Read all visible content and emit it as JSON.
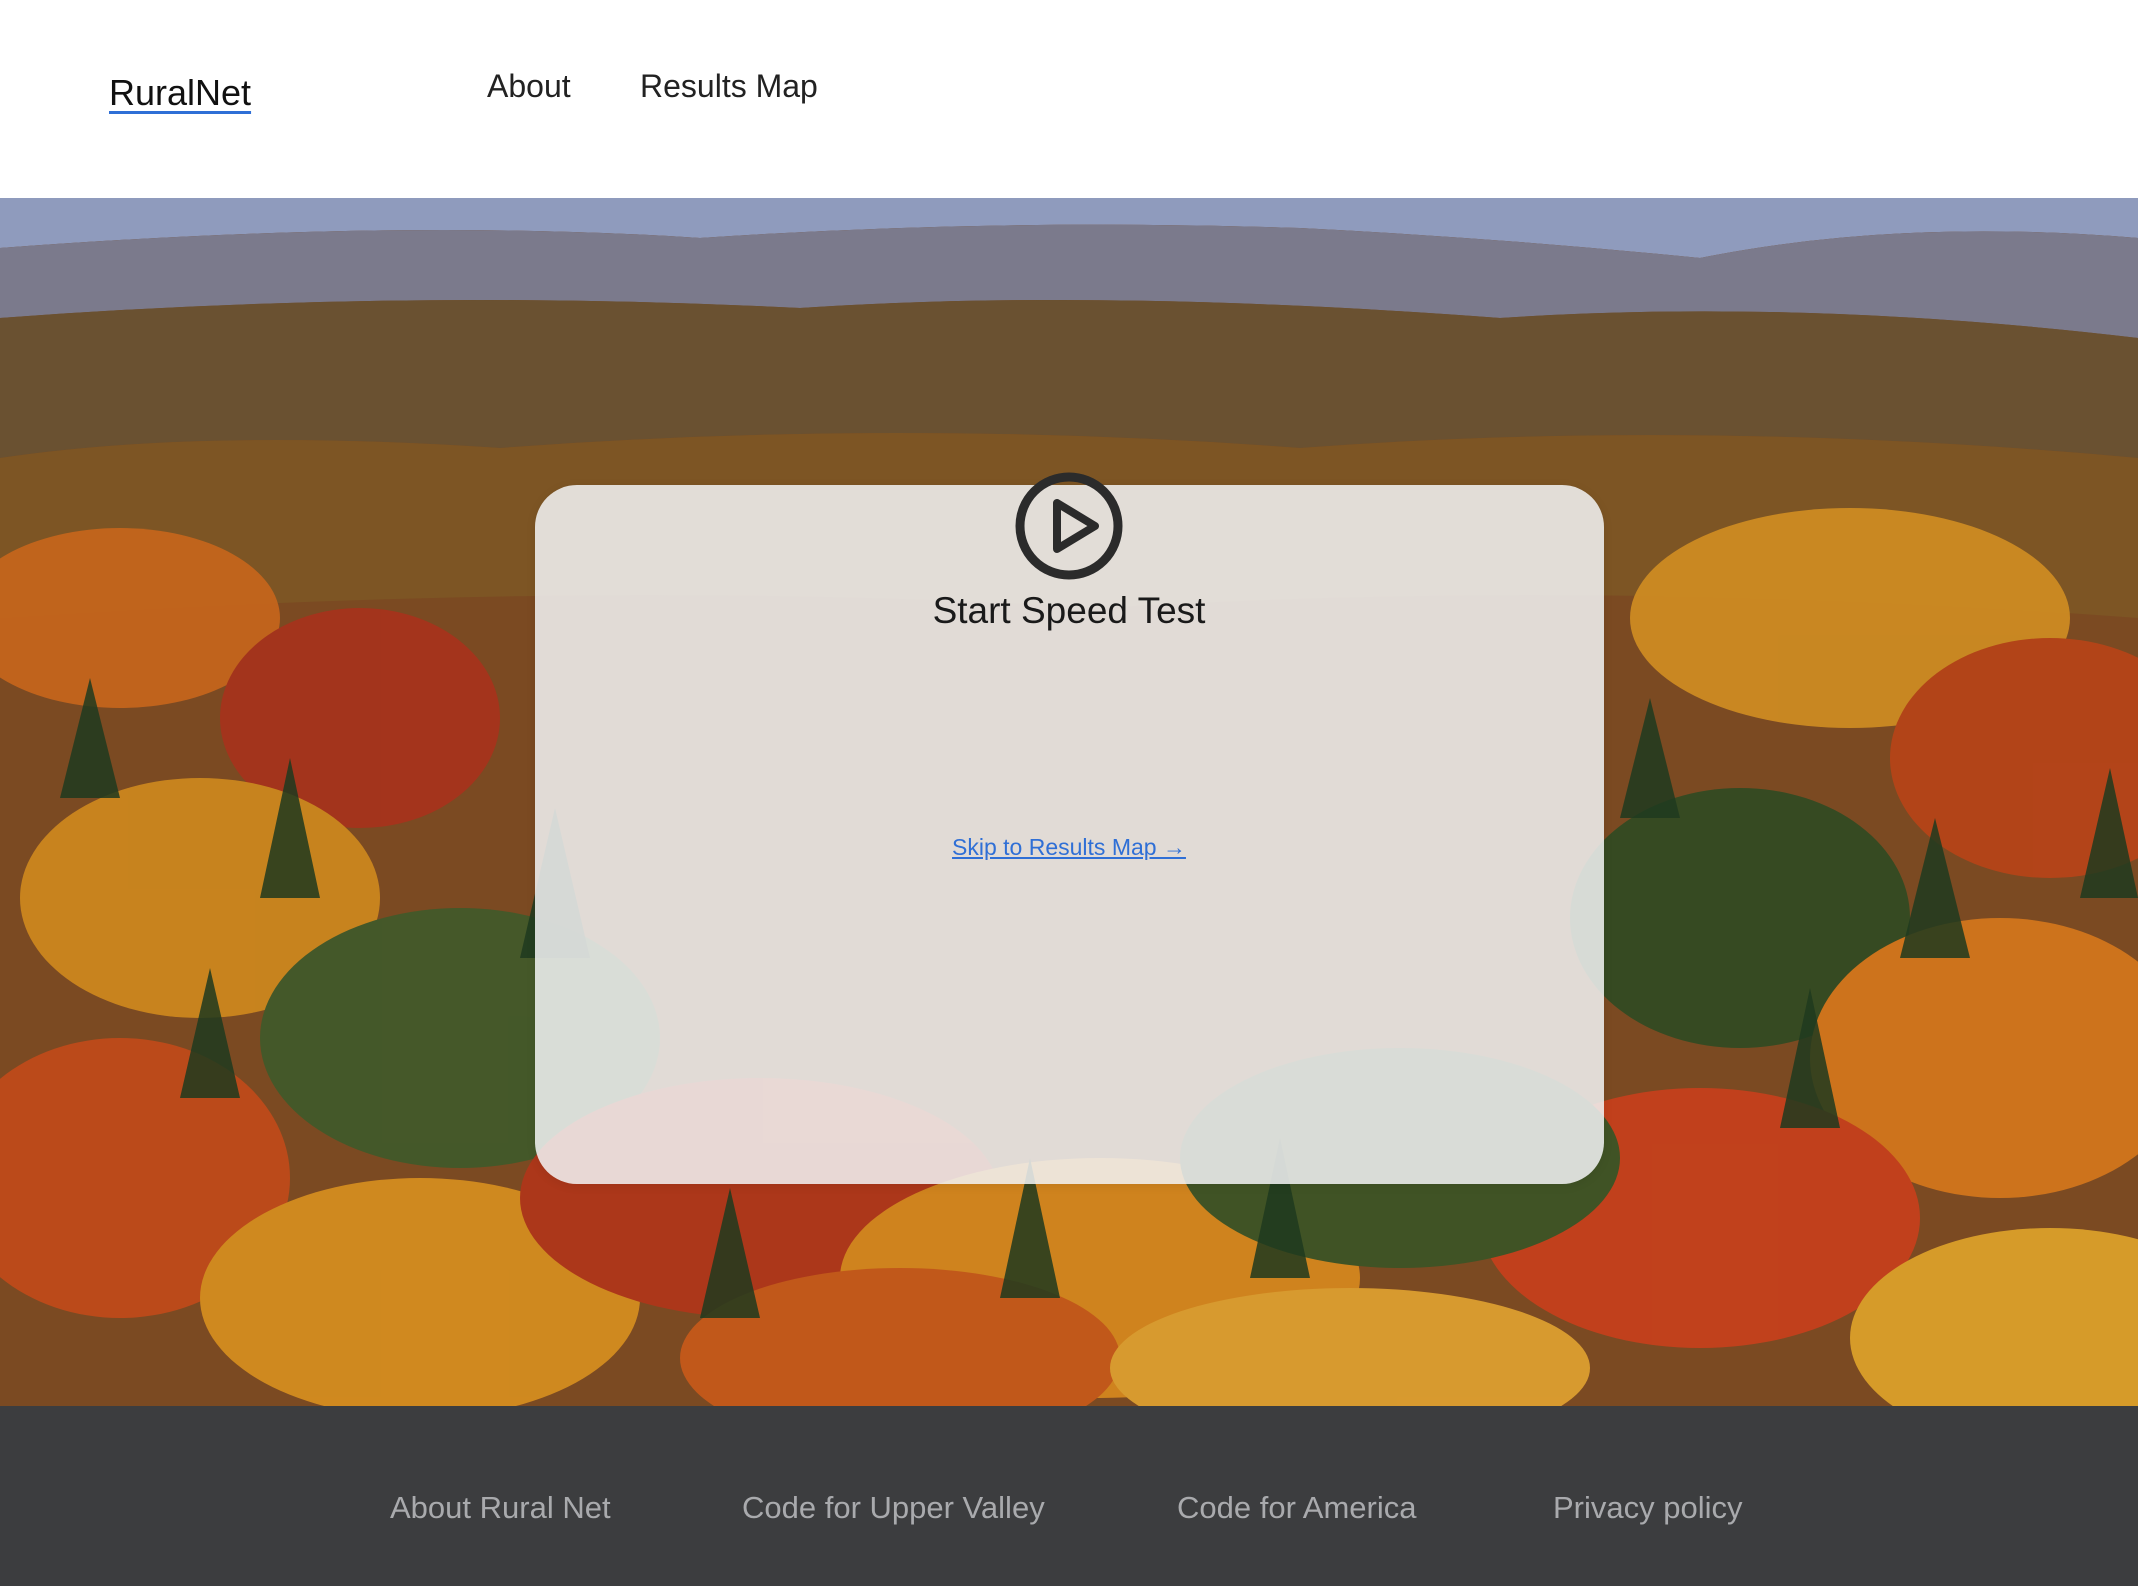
{
  "header": {
    "brand": "RuralNet",
    "nav": {
      "about": "About",
      "results_map": "Results Map"
    }
  },
  "hero": {
    "background_image": "autumn-forest-hillside",
    "card": {
      "play_icon": "play-circle-icon",
      "start_label": "Start Speed Test",
      "skip_link": "Skip to Results Map →"
    }
  },
  "footer": {
    "links": [
      "About Rural Net",
      "Code for Upper Valley",
      "Code for America",
      "Privacy policy"
    ]
  },
  "colors": {
    "link_blue": "#2f6fd6",
    "footer_bg": "#3c3d3f",
    "footer_text": "#a9aaad",
    "card_bg": "#f2f3f5"
  }
}
